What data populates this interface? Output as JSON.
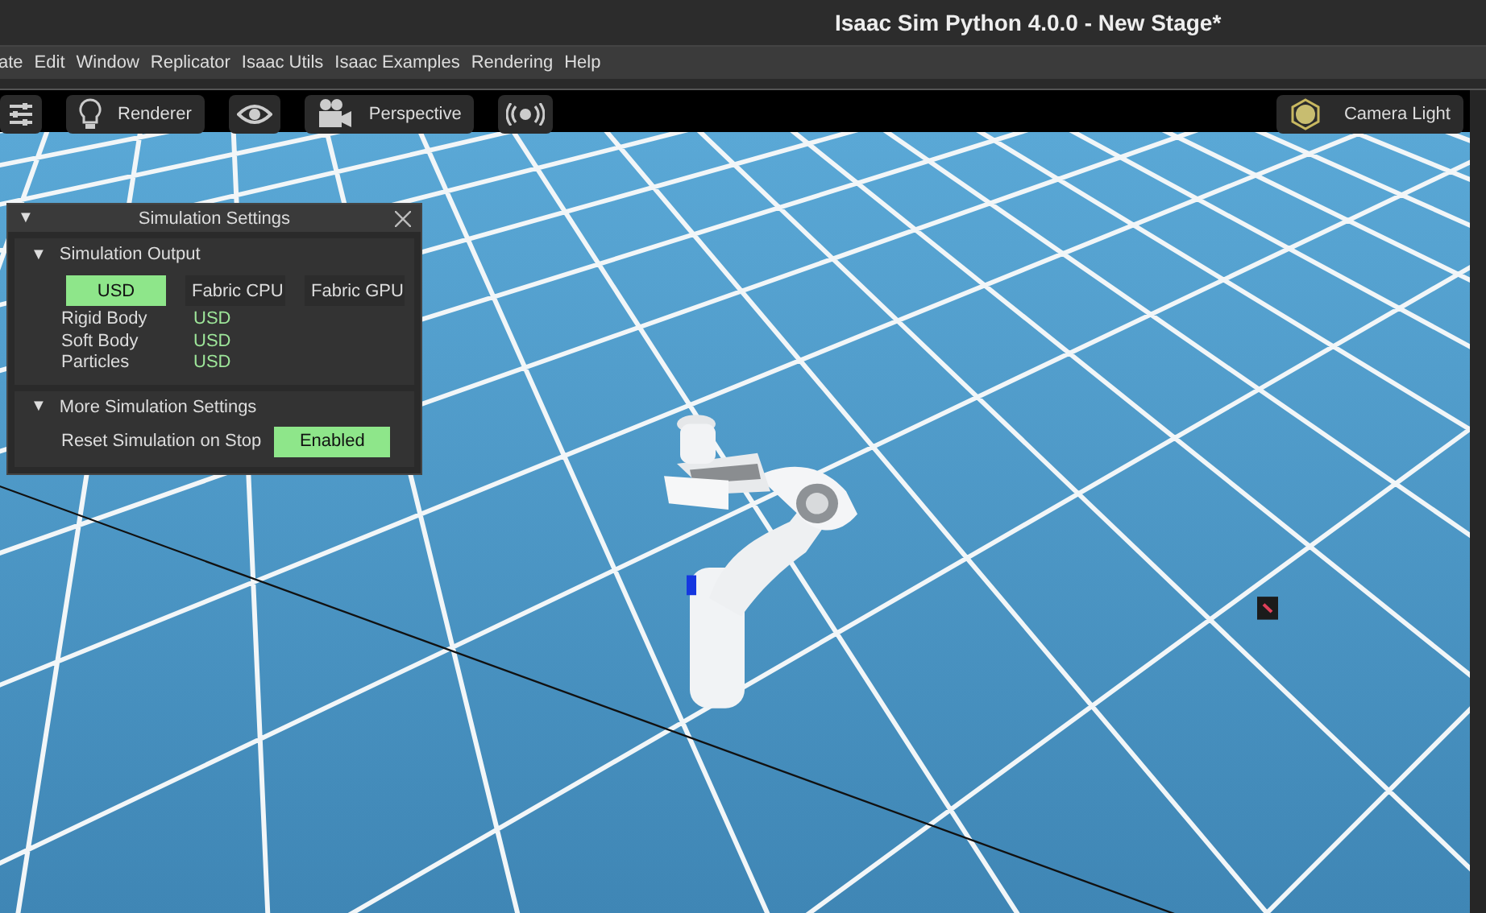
{
  "window": {
    "title": "Isaac Sim Python 4.0.0 - New Stage*"
  },
  "menu": [
    "ate",
    "Edit",
    "Window",
    "Replicator",
    "Isaac Utils",
    "Isaac Examples",
    "Rendering",
    "Help"
  ],
  "viewport_toolbar": {
    "renderer": "Renderer",
    "camera": "Perspective",
    "light": "Camera Light"
  },
  "simulation_settings": {
    "title": "Simulation Settings",
    "collapse_glyph": "▼",
    "output": {
      "title": "Simulation Output",
      "expanded": true,
      "modes": [
        {
          "label": "USD",
          "selected": true
        },
        {
          "label": "Fabric CPU",
          "selected": false
        },
        {
          "label": "Fabric GPU",
          "selected": false
        }
      ],
      "rows": [
        {
          "label": "Rigid Body",
          "value": "USD"
        },
        {
          "label": "Soft Body",
          "value": "USD"
        },
        {
          "label": "Particles",
          "value": "USD"
        }
      ]
    },
    "more": {
      "title": "More Simulation Settings",
      "expanded": true,
      "reset_label": "Reset Simulation on Stop",
      "reset_button": "Enabled",
      "on": true
    }
  }
}
